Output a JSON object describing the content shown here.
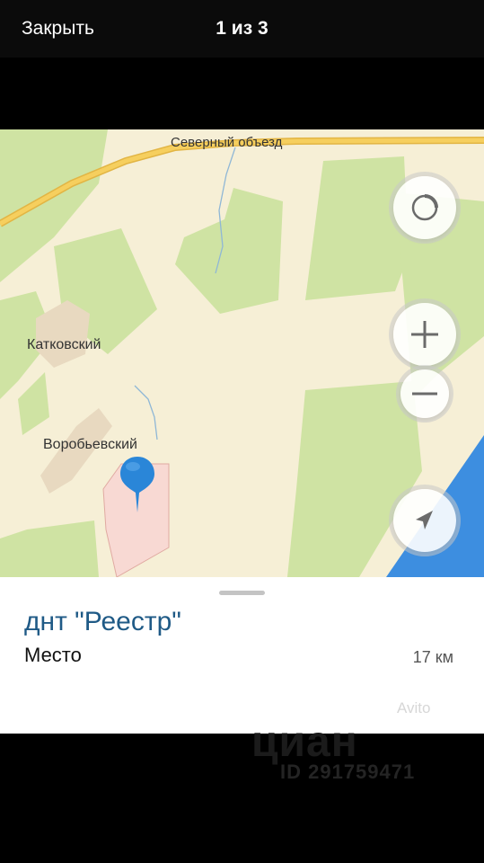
{
  "header": {
    "close_label": "Закрыть",
    "counter": "1 из 3"
  },
  "map": {
    "road_label": "Северный объезд",
    "place_labels": [
      "Катковский",
      "Воробьевский"
    ],
    "controls": [
      "compass-icon",
      "zoom-in-icon",
      "zoom-out-icon",
      "locate-me-icon"
    ],
    "colors": {
      "land": "#f6efd6",
      "forest": "#cfe3a3",
      "water": "#3d8ee0",
      "road": "#f0c24c",
      "pin": "#2a86d8"
    }
  },
  "place_card": {
    "title": "днт \"Реестр\"",
    "subtitle": "Место",
    "distance": "17 км"
  },
  "watermarks": {
    "avito": "Avito",
    "cian": "циан",
    "cian_id": "ID 291759471"
  }
}
